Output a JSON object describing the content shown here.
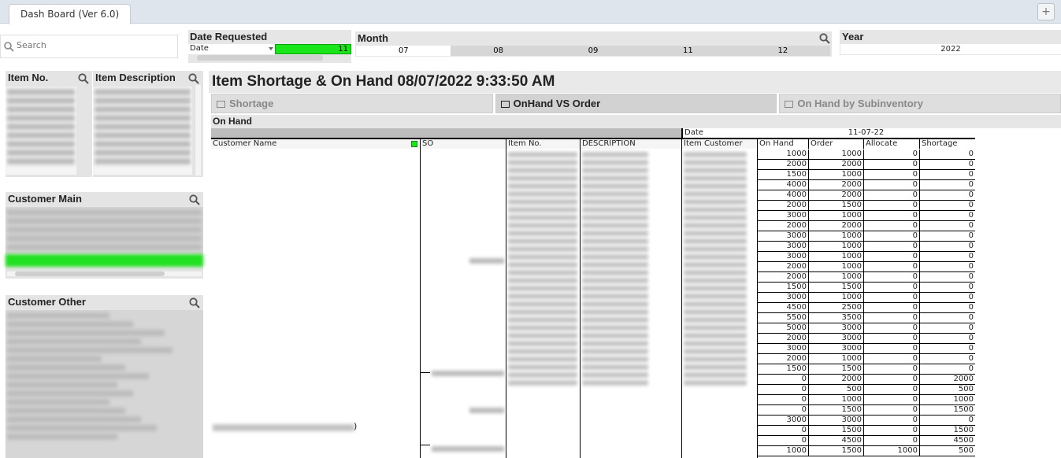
{
  "app": {
    "tab_label": "Dash Board (Ver 6.0)",
    "add_tab_label": "+"
  },
  "search": {
    "placeholder": "Search"
  },
  "date_requested": {
    "title": "Date Requested",
    "field_label": "Date",
    "selected_value": "11"
  },
  "month": {
    "title": "Month",
    "values": [
      "07",
      "08",
      "09",
      "11",
      "12"
    ],
    "selected": "07"
  },
  "year": {
    "title": "Year",
    "value": "2022"
  },
  "listboxes": {
    "item_no": "Item No.",
    "item_description": "Item Description",
    "customer_main": "Customer Main",
    "customer_other": "Customer Other"
  },
  "main": {
    "title": "Item Shortage & On Hand 08/07/2022 9:33:50 AM",
    "tabs": [
      "Shortage",
      "OnHand VS Order",
      "On Hand by Subinventory"
    ],
    "active_tab": "OnHand VS Order",
    "section_title": "On Hand"
  },
  "pivot": {
    "date_label": "Date",
    "date_value": "11-07-22",
    "columns": [
      "Customer Name",
      "SO",
      "Item No.",
      "DESCRIPTION",
      "Item Customer",
      "On Hand",
      "Order",
      "Allocate",
      "Shortage"
    ],
    "customer_suffix": ")",
    "rows": [
      [
        1000,
        1000,
        0,
        0
      ],
      [
        2000,
        2000,
        0,
        0
      ],
      [
        1500,
        1000,
        0,
        0
      ],
      [
        4000,
        2000,
        0,
        0
      ],
      [
        4000,
        2000,
        0,
        0
      ],
      [
        2000,
        1500,
        0,
        0
      ],
      [
        3000,
        1000,
        0,
        0
      ],
      [
        2000,
        2000,
        0,
        0
      ],
      [
        3000,
        1000,
        0,
        0
      ],
      [
        3000,
        1000,
        0,
        0
      ],
      [
        3000,
        1000,
        0,
        0
      ],
      [
        2000,
        1000,
        0,
        0
      ],
      [
        2000,
        1000,
        0,
        0
      ],
      [
        1500,
        1500,
        0,
        0
      ],
      [
        3000,
        1000,
        0,
        0
      ],
      [
        4500,
        2500,
        0,
        0
      ],
      [
        5500,
        3500,
        0,
        0
      ],
      [
        5000,
        3000,
        0,
        0
      ],
      [
        2000,
        3000,
        0,
        0
      ],
      [
        3000,
        3000,
        0,
        0
      ],
      [
        2000,
        1000,
        0,
        0
      ],
      [
        1500,
        1500,
        0,
        0
      ],
      [
        0,
        2000,
        0,
        2000
      ],
      [
        0,
        500,
        0,
        500
      ],
      [
        0,
        1000,
        0,
        1000
      ],
      [
        0,
        1500,
        0,
        1500
      ],
      [
        3000,
        3000,
        0,
        0
      ],
      [
        0,
        1500,
        0,
        1500
      ],
      [
        0,
        4500,
        0,
        4500
      ],
      [
        1000,
        1500,
        1000,
        500
      ]
    ]
  },
  "colors": {
    "selection_green": "#19e619",
    "header_gray": "#d9d9d9",
    "tabbar": "#dfe5ec"
  },
  "icons": [
    "search-icon",
    "plus-icon",
    "table-icon",
    "dropdown-arrow-icon"
  ]
}
